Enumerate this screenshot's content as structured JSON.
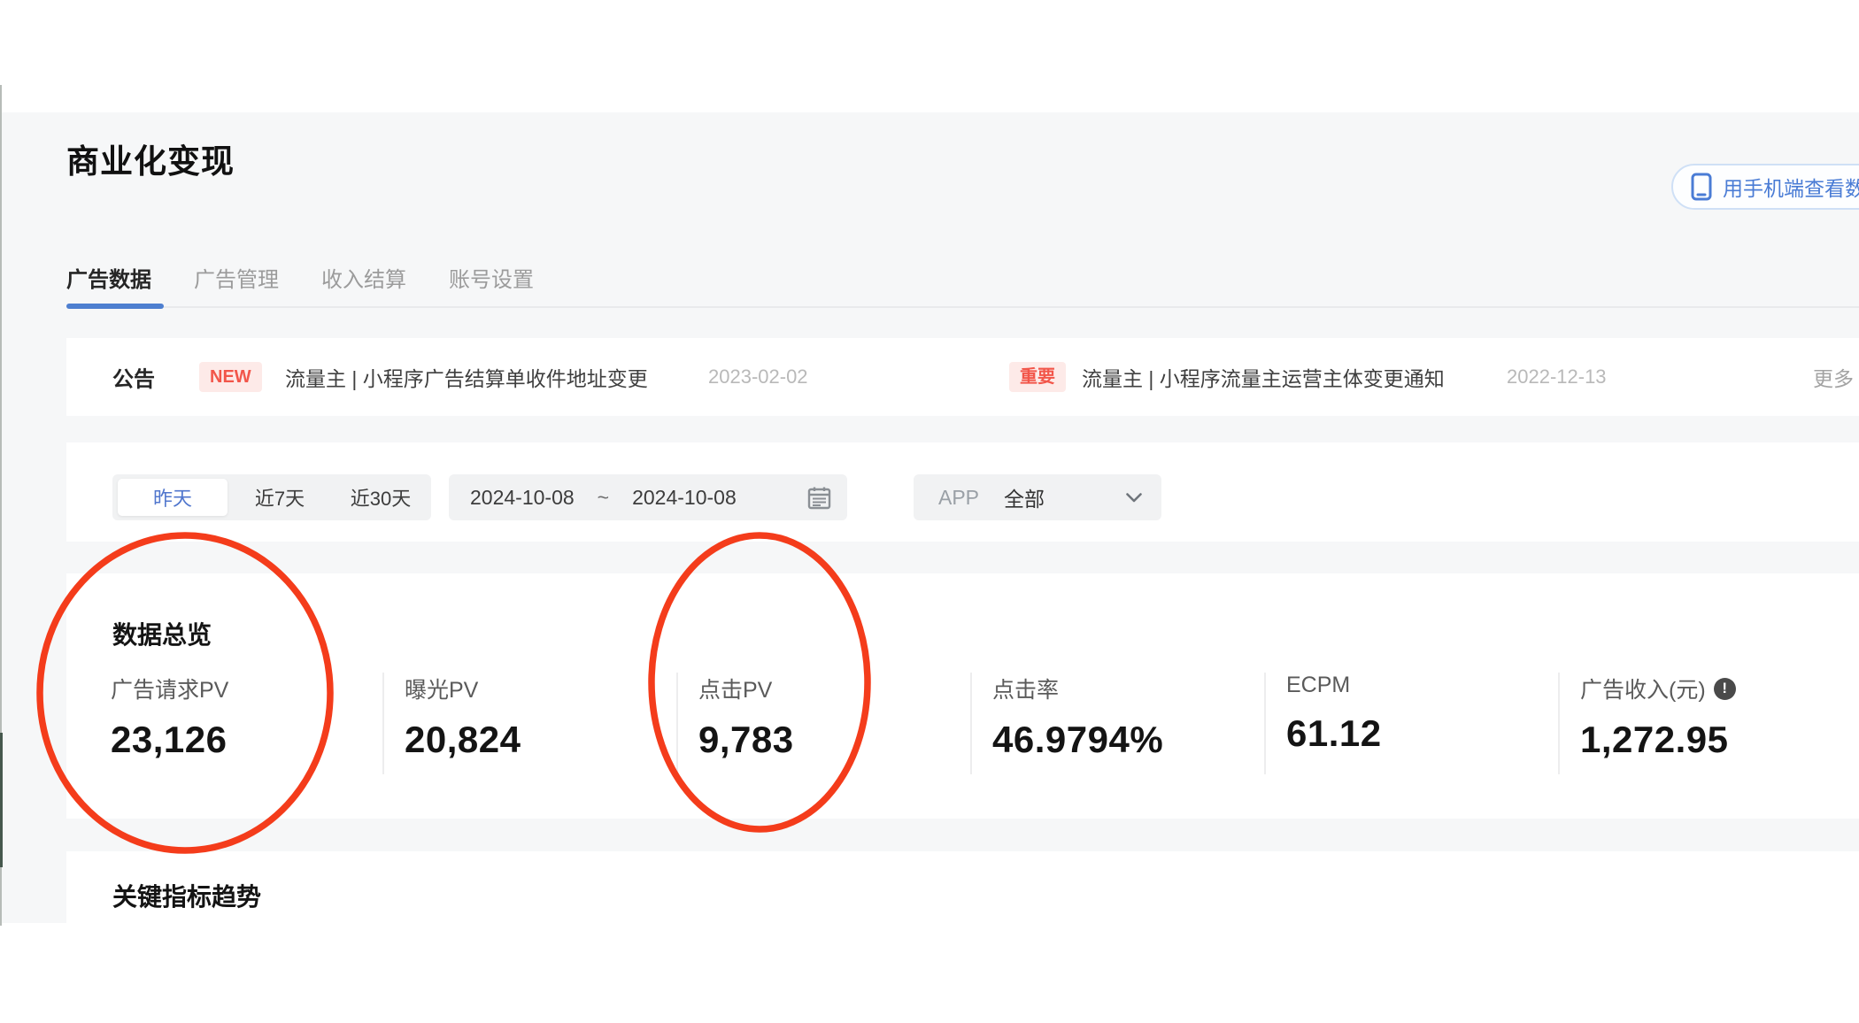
{
  "colors": {
    "accent_blue": "#4e7fd0",
    "page_background": "#f6f7f8",
    "badge_background": "#fdeae8",
    "badge_text": "#f2564a",
    "annotation_red": "#f43c1b"
  },
  "header": {
    "title": "商业化变现",
    "phone_button_label": "用手机端查看数据"
  },
  "tabs": [
    {
      "label": "广告数据",
      "active": true
    },
    {
      "label": "广告管理",
      "active": false
    },
    {
      "label": "收入结算",
      "active": false
    },
    {
      "label": "账号设置",
      "active": false
    }
  ],
  "announcement": {
    "label": "公告",
    "items": [
      {
        "badge": "NEW",
        "title": "流量主 | 小程序广告结算单收件地址变更",
        "date": "2023-02-02"
      },
      {
        "badge": "重要",
        "title": "流量主 | 小程序流量主运营主体变更通知",
        "date": "2022-12-13"
      }
    ],
    "more_label": "更多"
  },
  "filters": {
    "quick_ranges": [
      {
        "label": "昨天",
        "active": true
      },
      {
        "label": "近7天",
        "active": false
      },
      {
        "label": "近30天",
        "active": false
      }
    ],
    "date_range": {
      "start": "2024-10-08",
      "separator": "~",
      "end": "2024-10-08"
    },
    "app_filter": {
      "label": "APP",
      "value": "全部"
    }
  },
  "overview": {
    "title": "数据总览",
    "metrics": [
      {
        "label": "广告请求PV",
        "value": "23,126"
      },
      {
        "label": "曝光PV",
        "value": "20,824"
      },
      {
        "label": "点击PV",
        "value": "9,783"
      },
      {
        "label": "点击率",
        "value": "46.9794%"
      },
      {
        "label": "ECPM",
        "value": "61.12"
      },
      {
        "label": "广告收入(元)",
        "value": "1,272.95",
        "info_icon": "!"
      }
    ]
  },
  "trend": {
    "title": "关键指标趋势"
  }
}
